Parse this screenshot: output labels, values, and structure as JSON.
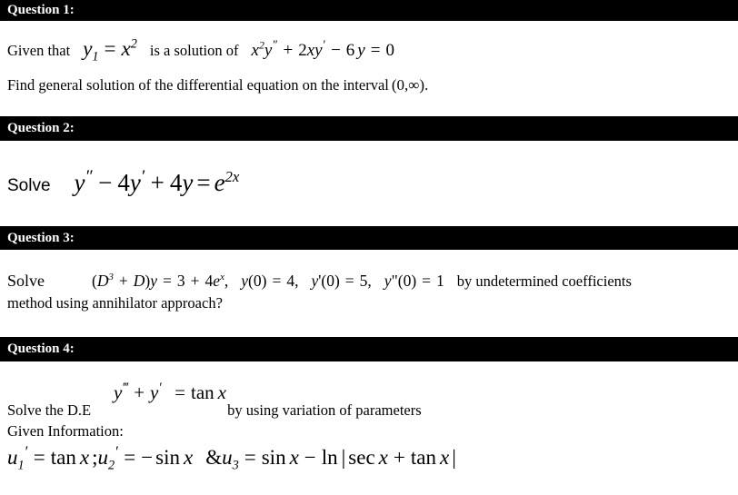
{
  "document": {
    "title": "Differential Equations Question Sheet",
    "background_color": "#ffffff",
    "header_bar_color": "#000000",
    "header_text_color": "#ffffff"
  },
  "questions": [
    {
      "id": "q1",
      "header": "Question 1:",
      "lines": [
        {
          "id": "q1l1",
          "parts": [
            {
              "kind": "text",
              "value": "Given that"
            },
            {
              "kind": "math",
              "value": "y₁ = x²"
            },
            {
              "kind": "text",
              "value": "is a solution of"
            },
            {
              "kind": "math",
              "value": "x²y″ + 2xy′ − 6y = 0"
            }
          ],
          "plain": "Given that y1 = x^2 is a solution of x^2 y'' + 2xy' - 6y = 0"
        },
        {
          "id": "q1l2",
          "parts": [
            {
              "kind": "text",
              "value": "Find general solution of the differential equation on the interval"
            },
            {
              "kind": "math",
              "value": "(0,∞)"
            },
            {
              "kind": "text",
              "value": "."
            }
          ],
          "plain": "Find general solution of the differential equation on the interval (0,∞)."
        }
      ]
    },
    {
      "id": "q2",
      "header": "Question 2:",
      "lines": [
        {
          "id": "q2l1",
          "parts": [
            {
              "kind": "text",
              "value": "Solve"
            },
            {
              "kind": "math",
              "value": "y″ − 4y′ + 4y = e²ˣ"
            }
          ],
          "plain": "Solve  y'' - 4y' + 4y = e^{2x}"
        }
      ]
    },
    {
      "id": "q3",
      "header": "Question 3:",
      "lines": [
        {
          "id": "q3l1",
          "parts": [
            {
              "kind": "text",
              "value": "Solve"
            },
            {
              "kind": "math",
              "value": "(D³ + D)y = 3 + 4eˣ,  y(0) = 4,  y'(0) = 5,  y\"(0) = 1"
            },
            {
              "kind": "text",
              "value": "by undetermined coefficients"
            }
          ],
          "plain": "Solve (D^3 + D)y = 3 + 4e^x, y(0) = 4, y'(0) = 5, y\"(0) = 1 by undetermined coefficients"
        },
        {
          "id": "q3l2",
          "parts": [
            {
              "kind": "text",
              "value": "method using annihilator approach?"
            }
          ],
          "plain": "method using annihilator approach?"
        }
      ]
    },
    {
      "id": "q4",
      "header": "Question 4:",
      "lines": [
        {
          "id": "q4l1",
          "parts": [
            {
              "kind": "text",
              "value": "Solve the D.E"
            },
            {
              "kind": "math",
              "value": "y‴ + y′ = tan x"
            },
            {
              "kind": "text",
              "value": "by using variation of parameters"
            }
          ],
          "plain": "Solve the D.E  y''' + y' = tan x  by using variation of parameters"
        },
        {
          "id": "q4l2",
          "parts": [
            {
              "kind": "text",
              "value": "Given Information:"
            }
          ],
          "plain": "Given Information:"
        },
        {
          "id": "q4l3",
          "parts": [
            {
              "kind": "math",
              "value": "u₁′ = tan x ; u₂′ = − sin x & u₃ = sin x − ln | sec x + tan x |"
            }
          ],
          "plain": "u1' = tan x ; u2' = - sin x & u3 = sin x - ln | sec x + tan x |"
        }
      ]
    }
  ],
  "text_fragments": {
    "q1_given_that": "Given that",
    "q1_is_a_solution_of": "is a solution of",
    "q1_find_general": "Find general solution of the differential equation on the interval",
    "q1_period": ".",
    "q2_solve": "Solve",
    "q3_solve": "Solve",
    "q3_by_undetermined": "by undetermined coefficients",
    "q3_method_line": "method using annihilator approach?",
    "q4_solve_the_de": "Solve the D.E",
    "q4_by_using": "by using variation of parameters",
    "q4_given_information": "Given Information:"
  },
  "math_symbols": {
    "y": "y",
    "x": "x",
    "D": "D",
    "u": "u",
    "e": "e",
    "tan": "tan",
    "sin": "sin",
    "sec": "sec",
    "ln": "ln",
    "equals": "=",
    "plus": "+",
    "minus": "−",
    "minus_ascii": "-",
    "ampersand": "&",
    "semicolon": ";",
    "comma": ",",
    "infinity": "∞",
    "bar": "|",
    "open_paren": "(",
    "close_paren": ")",
    "prime": "′",
    "double_prime": "″",
    "triple_prime": "‴",
    "apostrophe": "'",
    "quote": "\"",
    "zero": "0",
    "one": "1",
    "two": "2",
    "three": "3",
    "four": "4",
    "five": "5",
    "six": "6"
  }
}
